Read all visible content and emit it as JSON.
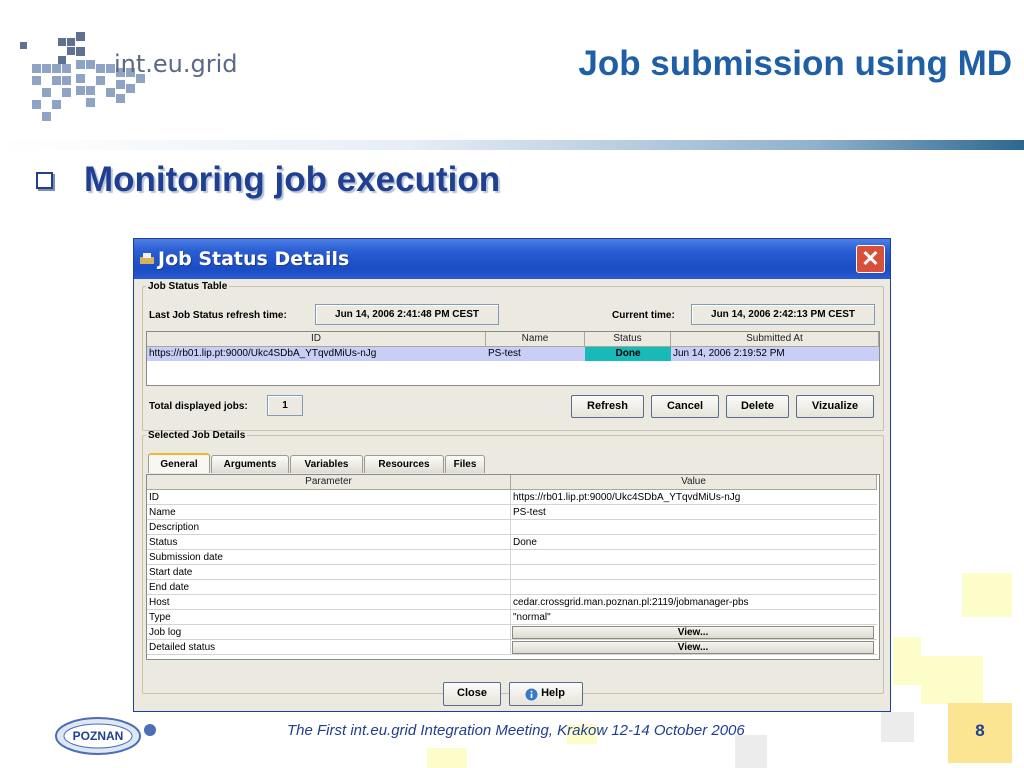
{
  "slide": {
    "logo_text": "int.eu.grid",
    "title": "Job submission using  MD",
    "bullet": "Monitoring job execution",
    "footer_logo_text": "POZNAN",
    "footer_text": "The First int.eu.grid Integration Meeting, Krakow 12-14 October 2006",
    "page_number": "8"
  },
  "window": {
    "title": "Job Status Details",
    "close_label": "✕",
    "status_group": {
      "legend": "Job Status Table",
      "refresh_label": "Last Job Status refresh time:",
      "refresh_value": "Jun 14, 2006 2:41:48 PM CEST",
      "current_label": "Current time:",
      "current_value": "Jun 14, 2006 2:42:13 PM CEST",
      "columns": [
        "ID",
        "Name",
        "Status",
        "Submitted At"
      ],
      "rows": [
        {
          "id": "https://rb01.lip.pt:9000/Ukc4SDbA_YTqvdMiUs-nJg",
          "name": "PS-test",
          "status": "Done",
          "submitted": "Jun 14, 2006 2:19:52 PM"
        }
      ],
      "total_label": "Total displayed jobs:",
      "total_value": "1",
      "buttons": {
        "refresh": "Refresh",
        "cancel": "Cancel",
        "delete": "Delete",
        "vizualize": "Vizualize"
      }
    },
    "details_group": {
      "legend": "Selected Job Details",
      "tabs": [
        "General",
        "Arguments",
        "Variables",
        "Resources",
        "Files"
      ],
      "active_tab": "General",
      "columns": [
        "Parameter",
        "Value"
      ],
      "rows": [
        {
          "param": "ID",
          "value": "https://rb01.lip.pt:9000/Ukc4SDbA_YTqvdMiUs-nJg"
        },
        {
          "param": "Name",
          "value": "PS-test"
        },
        {
          "param": "Description",
          "value": ""
        },
        {
          "param": "Status",
          "value": "Done"
        },
        {
          "param": "Submission date",
          "value": ""
        },
        {
          "param": "Start date",
          "value": ""
        },
        {
          "param": "End date",
          "value": ""
        },
        {
          "param": "Host",
          "value": "cedar.crossgrid.man.poznan.pl:2119/jobmanager-pbs"
        },
        {
          "param": "Type",
          "value": "\"normal\""
        },
        {
          "param": "Job log",
          "value": "View..."
        },
        {
          "param": "Detailed status",
          "value": "View..."
        }
      ]
    },
    "bottom_buttons": {
      "close": "Close",
      "help": "Help"
    }
  },
  "colors": {
    "title_blue": "#1f5fa6",
    "bullet_blue": "#1f3f90",
    "titlebar": "#2a5dd3",
    "done": "#17b9b9"
  },
  "icons": {
    "help": "info-icon",
    "title": "app-icon"
  }
}
